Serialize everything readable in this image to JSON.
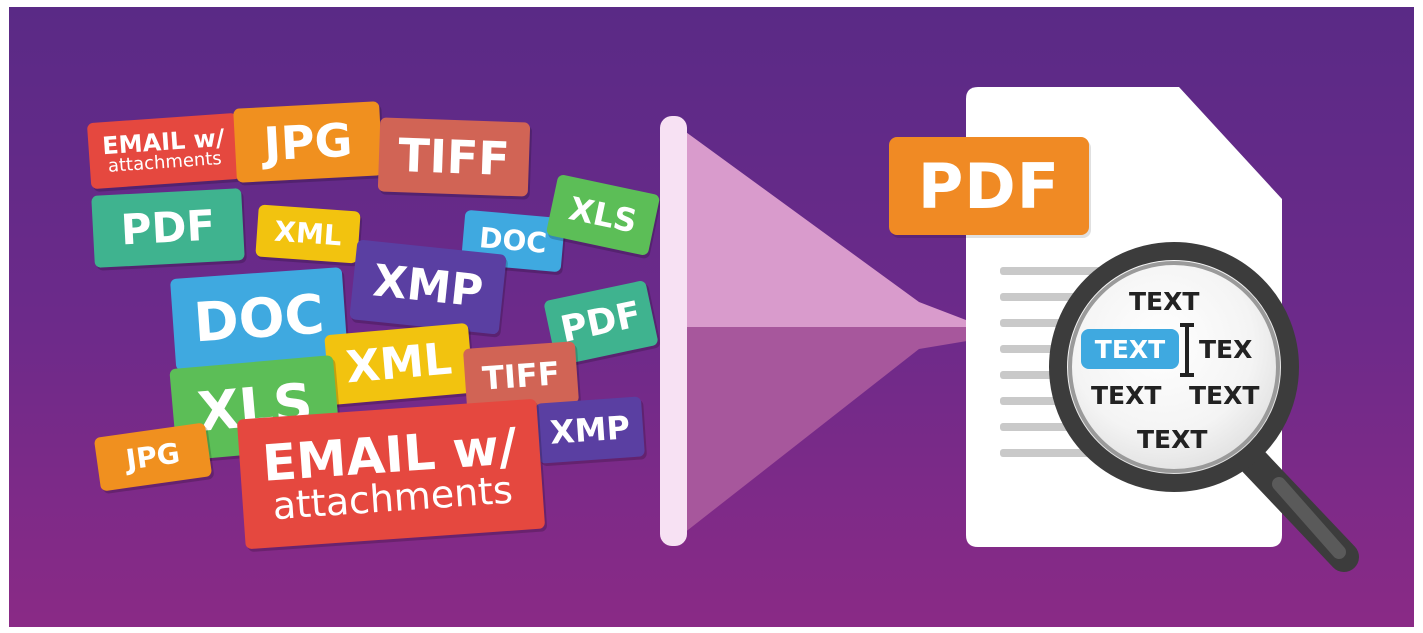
{
  "tags": [
    {
      "id": "email-small",
      "main": "EMAIL w/",
      "sub": "attachments",
      "color": "#e5483f"
    },
    {
      "id": "jpg-top",
      "label": "JPG",
      "color": "#f0901f"
    },
    {
      "id": "tiff-top",
      "label": "TIFF",
      "color": "#d16455"
    },
    {
      "id": "pdf-left",
      "label": "PDF",
      "color": "#3fb38f"
    },
    {
      "id": "xml-small",
      "label": "XML",
      "color": "#f2c30f"
    },
    {
      "id": "doc-small",
      "label": "DOC",
      "color": "#3fa9e0"
    },
    {
      "id": "xls-top",
      "label": "XLS",
      "color": "#5cbe57"
    },
    {
      "id": "xmp-mid",
      "label": "XMP",
      "color": "#5a3fa2"
    },
    {
      "id": "doc-big",
      "label": "DOC",
      "color": "#3fa9e0"
    },
    {
      "id": "pdf-right",
      "label": "PDF",
      "color": "#3fb38f"
    },
    {
      "id": "xml-mid",
      "label": "XML",
      "color": "#f2c30f"
    },
    {
      "id": "tiff-mid",
      "label": "TIFF",
      "color": "#d16455"
    },
    {
      "id": "xls-big",
      "label": "XLS",
      "color": "#5cbe57"
    },
    {
      "id": "jpg-bottom",
      "label": "JPG",
      "color": "#f0901f"
    },
    {
      "id": "xmp-bottom",
      "label": "XMP",
      "color": "#5a3fa2"
    },
    {
      "id": "email-big",
      "main": "EMAIL w/",
      "sub": "attachments",
      "color": "#e5483f"
    }
  ],
  "output": {
    "badge_label": "PDF",
    "badge_color": "#f08a24",
    "highlight_color": "#3fa9e0",
    "lens_words": {
      "row1": "TEXT",
      "highlighted": "TEXT",
      "row2_right": "TEX",
      "row3_left": "TEXT",
      "row3_right": "TEXT",
      "row4": "TEXT"
    }
  },
  "colors": {
    "background_top": "#5a2a86",
    "background_bottom": "#8a2a86",
    "funnel_light": "#d99bcc",
    "funnel_dark": "#a7579c",
    "document": "#ffffff"
  },
  "icons": [
    "magnifier-icon",
    "text-cursor-icon",
    "funnel-icon",
    "document-icon"
  ]
}
